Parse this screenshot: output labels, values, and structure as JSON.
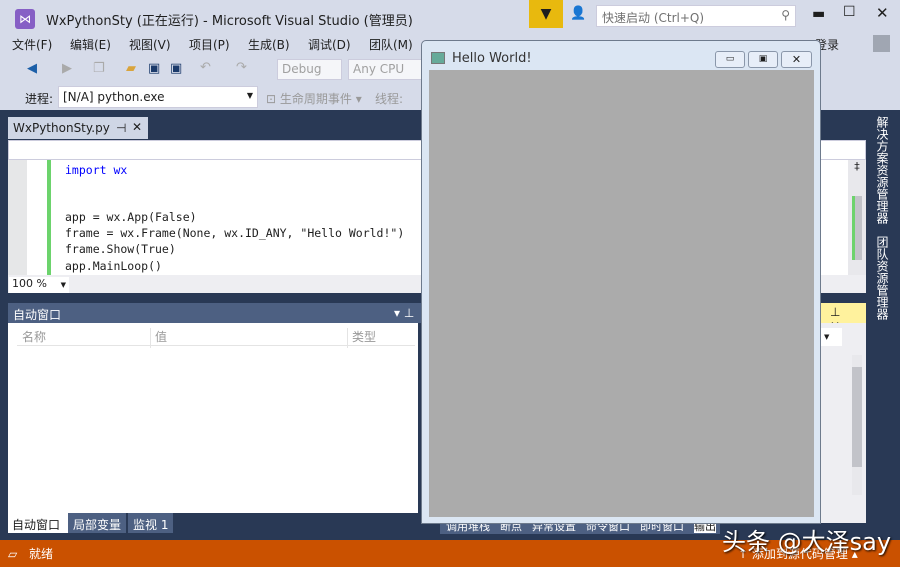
{
  "window": {
    "title": "WxPythonSty (正在运行) - Microsoft Visual Studio (管理员)",
    "quick_launch_placeholder": "快速启动 (Ctrl+Q)",
    "login": "登录"
  },
  "menu": [
    "文件(F)",
    "编辑(E)",
    "视图(V)",
    "项目(P)",
    "生成(B)",
    "调试(D)",
    "团队(M)"
  ],
  "toolbar": {
    "config": "Debug",
    "platform": "Any CPU",
    "process_label": "进程:",
    "process_value": "[N/A] python.exe",
    "lifecycle": "生命周期事件",
    "thread_label": "线程:"
  },
  "editor": {
    "tab": "WxPythonSty.py",
    "zoom": "100 %",
    "lines": [
      "import wx",
      "",
      "",
      "app = wx.App(False)",
      "frame = wx.Frame(None, wx.ID_ANY, \"Hello World!\")",
      "frame.Show(True)",
      "app.MainLoop()"
    ]
  },
  "autos": {
    "title": "自动窗口",
    "columns": [
      "名称",
      "值",
      "类型"
    ],
    "tabs": [
      "自动窗口",
      "局部变量",
      "监视 1"
    ]
  },
  "bottom_tabs": [
    "调用堆栈",
    "断点",
    "异常设置",
    "命令窗口",
    "即时窗口",
    "输出"
  ],
  "side": [
    "解决方案资源管理器",
    "团队资源管理器"
  ],
  "status": {
    "text": "就绪",
    "source_control": "添加到源代码管理",
    "color": "#ca5100"
  },
  "hello": {
    "title": "Hello World!"
  },
  "watermark": "头条 @大泽say"
}
